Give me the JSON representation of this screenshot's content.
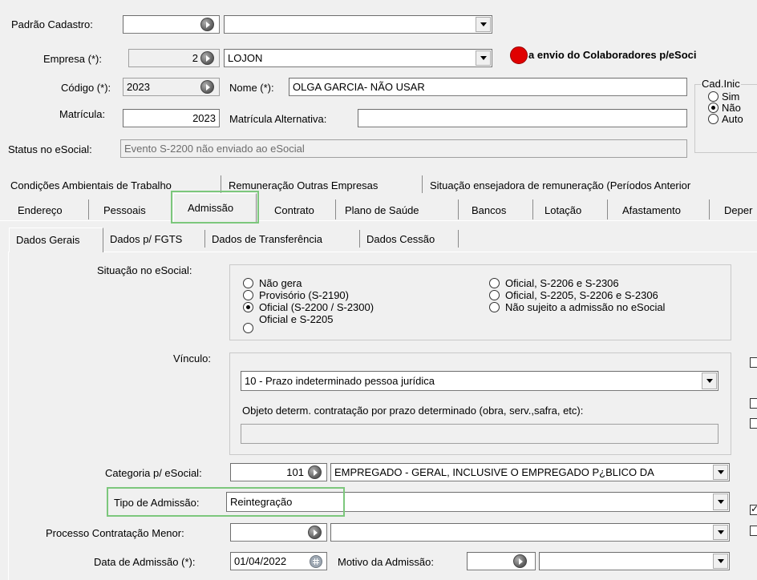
{
  "header": {
    "padrao_cadastro_label": "Padrão Cadastro:",
    "padrao_cadastro_value": "",
    "padrao_cadastro_desc": "",
    "empresa_label": "Empresa (*):",
    "empresa_code": "2",
    "empresa_name": "LOJON",
    "esocial_notice": "a envio do Colaboradores p/eSoci",
    "codigo_label": "Código (*):",
    "codigo_value": "2023",
    "nome_label": "Nome (*):",
    "nome_value": "OLGA GARCIA- NÃO USAR",
    "matricula_label": "Matrícula:",
    "matricula_value": "2023",
    "matricula_alt_label": "Matrícula Alternativa:",
    "matricula_alt_value": "",
    "status_label": "Status no eSocial:",
    "status_value": "Evento S-2200 não enviado ao eSocial",
    "cad_group_label": "Cad.Inic",
    "cad_options": [
      "Sim",
      "Não",
      "Auto"
    ],
    "cad_selected": "Não"
  },
  "tabs_row1": [
    "Condições Ambientais de Trabalho",
    "Remuneração Outras Empresas",
    "Situação ensejadora de remuneração (Períodos Anterior"
  ],
  "tabs_row2": [
    "Endereço",
    "Pessoais",
    "Admissão",
    "Contrato",
    "Plano de Saúde",
    "Bancos",
    "Lotação",
    "Afastamento",
    "Deper"
  ],
  "active_tab": "Admissão",
  "subtabs": [
    "Dados Gerais",
    "Dados p/ FGTS",
    "Dados de Transferência",
    "Dados Cessão"
  ],
  "active_subtab": "Dados Gerais",
  "situacao": {
    "label": "Situação no eSocial:",
    "options_left": [
      "Não gera",
      "Provisório (S-2190)",
      "Oficial (S-2200 / S-2300)",
      "Oficial e S-2205"
    ],
    "options_right": [
      "Oficial, S-2206 e S-2306",
      "Oficial, S-2205, S-2206 e S-2306",
      "Não sujeito a admissão no eSocial"
    ],
    "selected": "Oficial (S-2200 / S-2300)"
  },
  "vinculo": {
    "label": "Vínculo:",
    "value": "10 - Prazo indeterminado pessoa jurídica",
    "objeto_label": "Objeto determ. contratação por prazo determinado (obra, serv.,safra, etc):",
    "objeto_value": ""
  },
  "categoria": {
    "label": "Categoria p/ eSocial:",
    "code": "101",
    "desc": "EMPREGADO - GERAL, INCLUSIVE O EMPREGADO P¿BLICO DA"
  },
  "tipo_admissao": {
    "label": "Tipo de Admissão:",
    "value": "Reintegração"
  },
  "processo_menor": {
    "label": "Processo Contratação Menor:",
    "value": "",
    "desc": ""
  },
  "data_admissao": {
    "label": "Data de Admissão (*):",
    "value": "01/04/2022",
    "motivo_label": "Motivo da Admissão:",
    "motivo_value": "",
    "motivo_desc": ""
  },
  "right_checkboxes": [
    false,
    false,
    false,
    true,
    false
  ],
  "colors": {
    "highlight": "#7cc77c",
    "status_dot": "#e00000",
    "window_bg": "#f0f0f0"
  }
}
